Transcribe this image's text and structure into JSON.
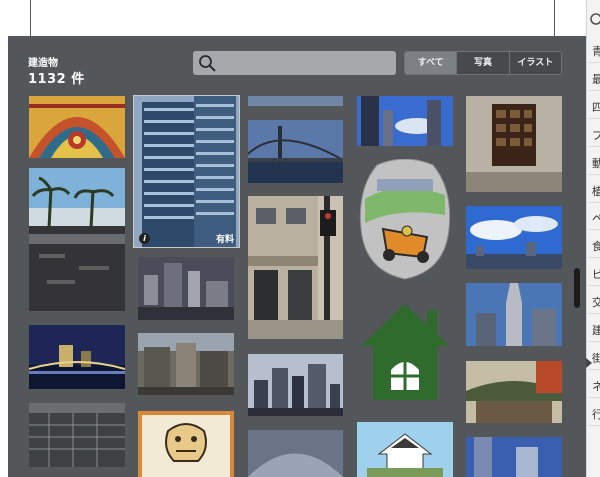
{
  "category": {
    "title": "建造物",
    "count": "1132 件"
  },
  "search": {
    "placeholder": "",
    "value": ""
  },
  "filters": [
    {
      "label": "すべて",
      "active": true
    },
    {
      "label": "写真",
      "active": false
    },
    {
      "label": "イラスト",
      "active": false
    }
  ],
  "tile_badges": {
    "paid_label": "有料",
    "info_label": "i"
  },
  "sidebar": {
    "items": [
      {
        "label": "青"
      },
      {
        "label": "最"
      },
      {
        "label": "四"
      },
      {
        "label": "プ"
      },
      {
        "label": "動"
      },
      {
        "label": "植"
      },
      {
        "label": "ペ"
      },
      {
        "label": "食"
      },
      {
        "label": "ビ"
      },
      {
        "label": "交"
      },
      {
        "label": "建"
      },
      {
        "label": "街"
      },
      {
        "label": "ネ"
      },
      {
        "label": "行"
      }
    ]
  },
  "colors": {
    "panel_bg": "#54575a",
    "search_bg": "#a6a8ab",
    "active_filter": "#7d8084",
    "house_green": "#2f6b2c"
  }
}
